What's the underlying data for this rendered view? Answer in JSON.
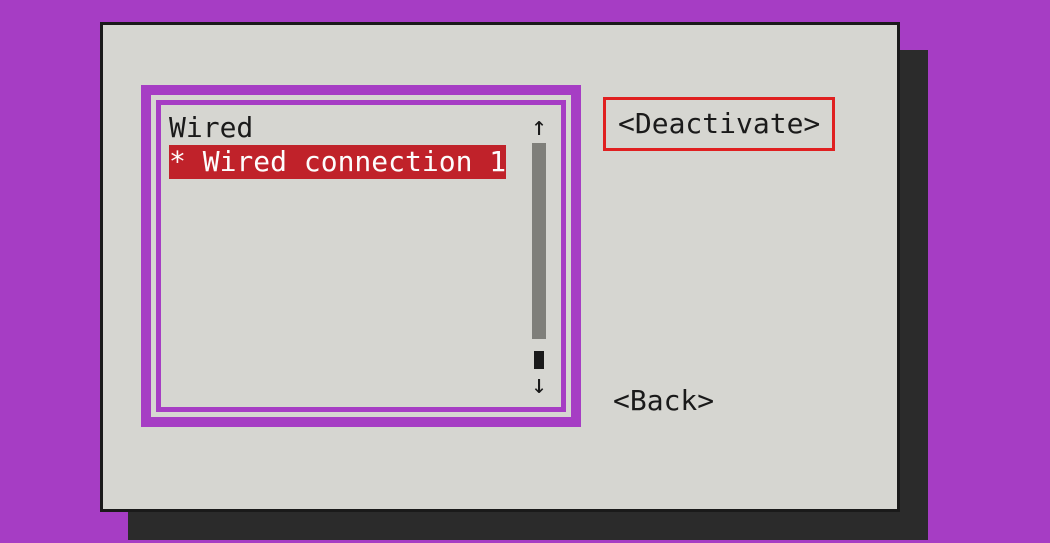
{
  "colors": {
    "background": "#a63dc4",
    "panel": "#d6d6d1",
    "border": "#1a1a1a",
    "highlight_bg": "#c0222a",
    "highlight_fg": "#fdfdfd",
    "annotation": "#e02020"
  },
  "list": {
    "header": "Wired",
    "items": [
      {
        "label": "* Wired connection 1",
        "selected": true
      }
    ]
  },
  "buttons": {
    "deactivate": "<Deactivate>",
    "back": "<Back>"
  },
  "scroll": {
    "up_arrow": "↑",
    "down_arrow": "↓"
  }
}
